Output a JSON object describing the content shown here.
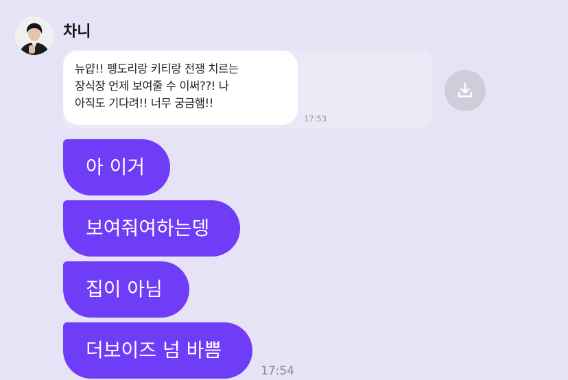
{
  "chat": {
    "sender_name": "차니",
    "quoted_message": {
      "lines": [
        "뉴얍!! 펭도리랑 키티랑 전쟁 치르는",
        "장식장 언제 보여줄 수 이써??! 나",
        "아직도 기다려!! 너무 궁금햄!!"
      ],
      "time": "17:53"
    },
    "messages": [
      {
        "text": "아 이거"
      },
      {
        "text": "보여줘여하는뎅"
      },
      {
        "text": "집이 아님"
      },
      {
        "text": "더보이즈 넘 바쁨"
      }
    ],
    "last_time": "17:54"
  },
  "icons": {
    "download": "download-icon"
  },
  "colors": {
    "background": "#e7e3f7",
    "bubble_purple": "#6f3cf7",
    "download_button": "#d0cdda"
  }
}
